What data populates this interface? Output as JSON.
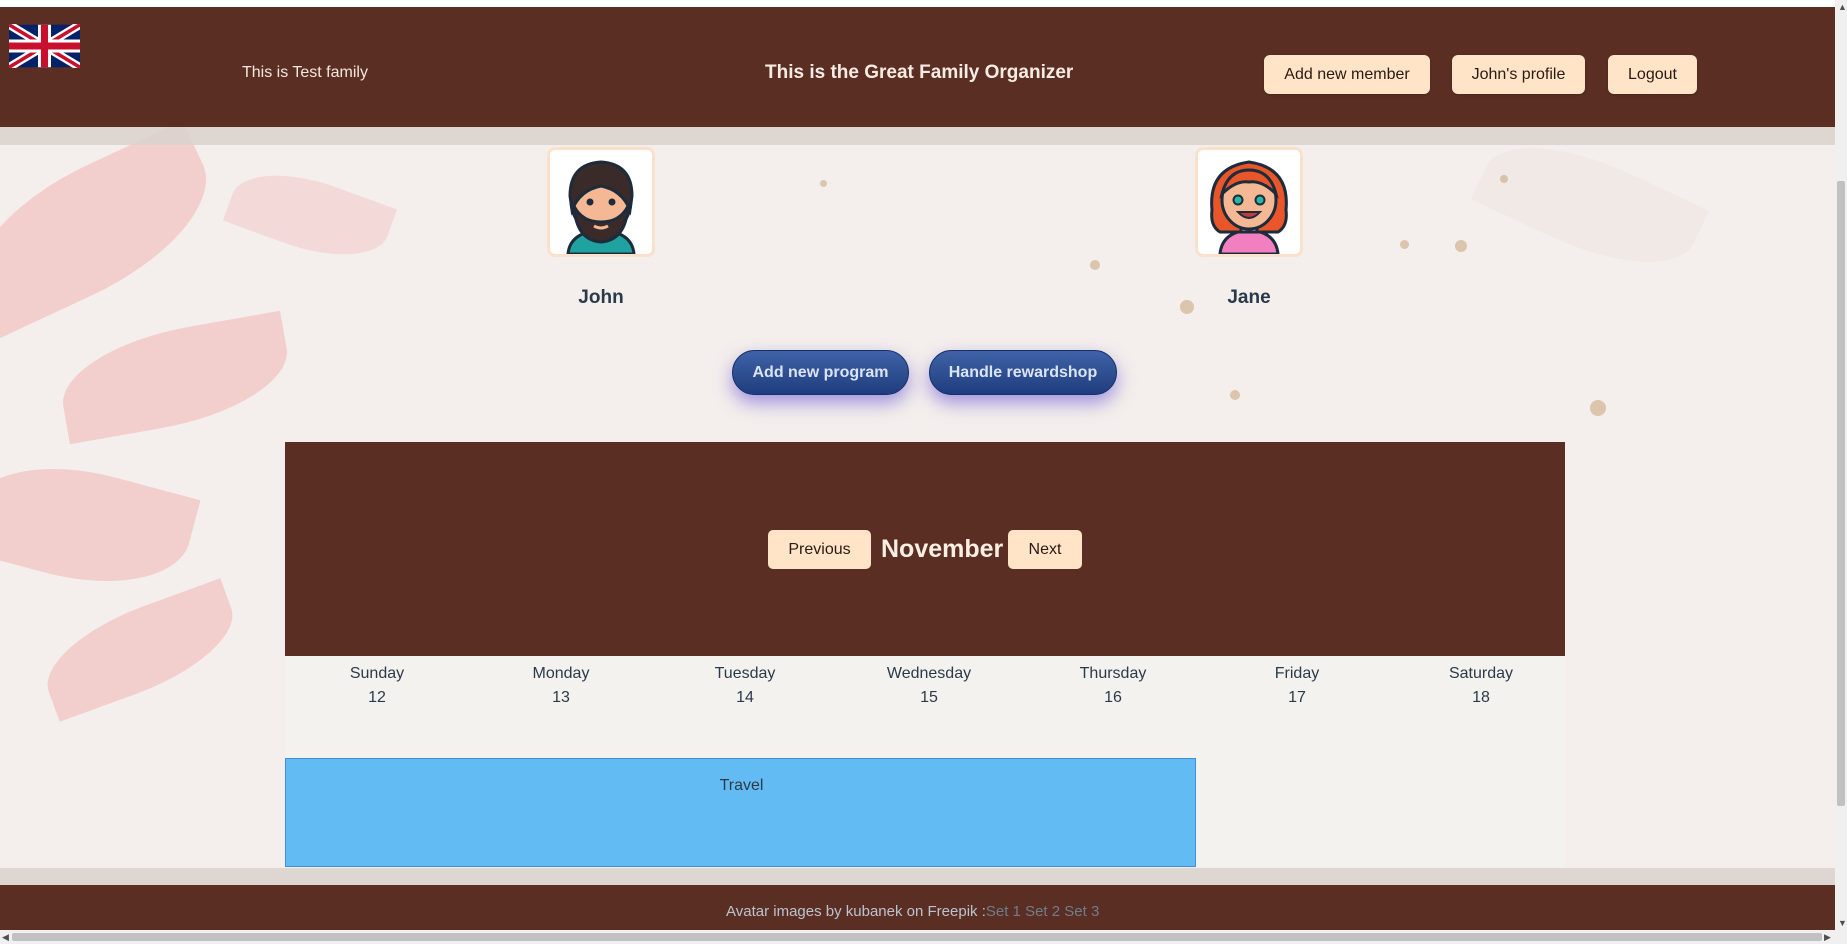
{
  "header": {
    "family_name": "This is Test family",
    "app_title": "This is the Great Family Organizer",
    "flag_icon": "uk-flag-icon",
    "buttons": {
      "add_member": "Add new member",
      "profile": "John's profile",
      "logout": "Logout"
    }
  },
  "members": [
    {
      "name": "John",
      "avatar": "bearded-man-avatar"
    },
    {
      "name": "Jane",
      "avatar": "redhead-woman-avatar"
    }
  ],
  "actions": {
    "add_program": "Add new program",
    "rewardshop": "Handle rewardshop"
  },
  "calendar": {
    "month": "November",
    "previous": "Previous",
    "next": "Next",
    "days": [
      {
        "name": "Sunday",
        "date": "12"
      },
      {
        "name": "Monday",
        "date": "13"
      },
      {
        "name": "Tuesday",
        "date": "14"
      },
      {
        "name": "Wednesday",
        "date": "15"
      },
      {
        "name": "Thursday",
        "date": "16"
      },
      {
        "name": "Friday",
        "date": "17"
      },
      {
        "name": "Saturday",
        "date": "18"
      }
    ],
    "event": {
      "label": "Travel",
      "color": "#62bcf3"
    }
  },
  "footer": {
    "credit": "Avatar images by kubanek on Freepik :",
    "links": [
      "Set 1",
      "Set 2",
      "Set 3"
    ]
  },
  "colors": {
    "header_bg": "#5b2e24",
    "button_bg": "#ffe4c8",
    "pill_bg": "#2b4c90"
  }
}
